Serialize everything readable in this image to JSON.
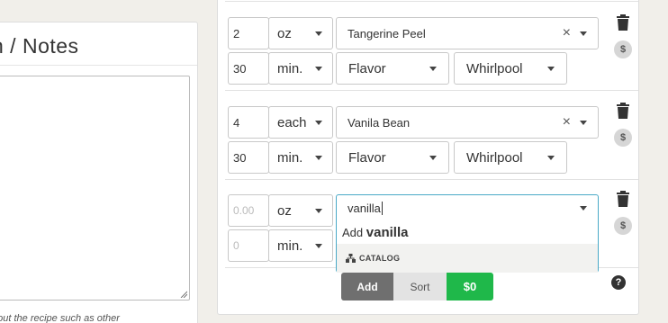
{
  "notes": {
    "title": "n / Notes",
    "hint": "bout the recipe such as other"
  },
  "ingredients": [
    {
      "amount": "2",
      "unit": "oz",
      "name": "Tangerine Peel",
      "time": "30",
      "time_unit": "min.",
      "use": "Flavor",
      "stage": "Whirlpool"
    },
    {
      "amount": "4",
      "unit": "each",
      "name": "Vanila Bean",
      "time": "30",
      "time_unit": "min.",
      "use": "Flavor",
      "stage": "Whirlpool"
    }
  ],
  "new_ingredient": {
    "amount_placeholder": "0.00",
    "unit": "oz",
    "search_value": "vanilla",
    "time_placeholder": "0",
    "time_unit": "min."
  },
  "dropdown": {
    "add_prefix": "Add",
    "add_term": "vanilla",
    "catalog_label": "CATALOG"
  },
  "buttons": {
    "add": "Add",
    "sort": "Sort",
    "cost": "$0"
  },
  "icons": {
    "clear": "×",
    "cost": "$",
    "help": "?"
  }
}
